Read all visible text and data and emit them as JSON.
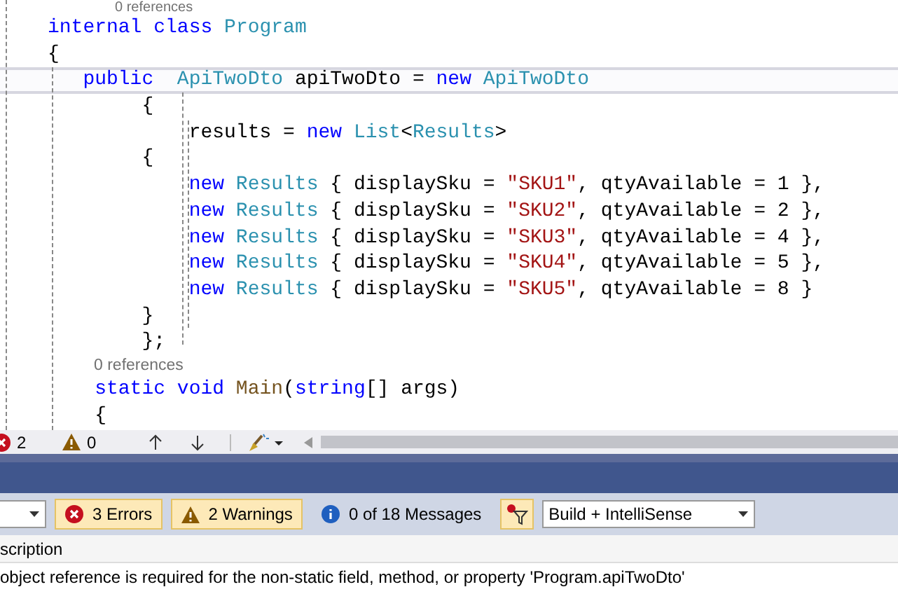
{
  "editor": {
    "lines": [
      {
        "kind": "lens",
        "text": "0 references"
      },
      {
        "kind": "code",
        "current": false,
        "tokens": [
          {
            "kind": "keyword",
            "s": "internal "
          },
          {
            "kind": "keyword",
            "s": "class "
          },
          {
            "kind": "type",
            "s": "Program"
          }
        ]
      },
      {
        "kind": "code",
        "current": false,
        "tokens": [
          {
            "kind": "plain",
            "s": "{"
          }
        ]
      },
      {
        "kind": "code",
        "current": true,
        "tokens": [
          {
            "kind": "keyword",
            "s": "   public  "
          },
          {
            "kind": "type",
            "s": "ApiTwoDto "
          },
          {
            "kind": "plain",
            "s": "apiTwoDto = "
          },
          {
            "kind": "keyword",
            "s": "new "
          },
          {
            "kind": "type",
            "s": "ApiTwoDto"
          }
        ]
      },
      {
        "kind": "code",
        "current": false,
        "tokens": [
          {
            "kind": "plain",
            "s": "        {"
          }
        ]
      },
      {
        "kind": "code",
        "current": false,
        "tokens": [
          {
            "kind": "plain",
            "s": "            results = "
          },
          {
            "kind": "keyword",
            "s": "new "
          },
          {
            "kind": "type",
            "s": "List"
          },
          {
            "kind": "plain",
            "s": "<"
          },
          {
            "kind": "type",
            "s": "Results"
          },
          {
            "kind": "plain",
            "s": ">"
          }
        ]
      },
      {
        "kind": "code",
        "current": false,
        "tokens": [
          {
            "kind": "plain",
            "s": "        {"
          }
        ]
      },
      {
        "kind": "code",
        "current": false,
        "tokens": [
          {
            "kind": "keyword",
            "s": "            new "
          },
          {
            "kind": "type",
            "s": "Results "
          },
          {
            "kind": "plain",
            "s": "{ displaySku = "
          },
          {
            "kind": "string",
            "s": "\"SKU1\""
          },
          {
            "kind": "plain",
            "s": ", qtyAvailable = 1 },"
          }
        ]
      },
      {
        "kind": "code",
        "current": false,
        "tokens": [
          {
            "kind": "keyword",
            "s": "            new "
          },
          {
            "kind": "type",
            "s": "Results "
          },
          {
            "kind": "plain",
            "s": "{ displaySku = "
          },
          {
            "kind": "string",
            "s": "\"SKU2\""
          },
          {
            "kind": "plain",
            "s": ", qtyAvailable = 2 },"
          }
        ]
      },
      {
        "kind": "code",
        "current": false,
        "tokens": [
          {
            "kind": "keyword",
            "s": "            new "
          },
          {
            "kind": "type",
            "s": "Results "
          },
          {
            "kind": "plain",
            "s": "{ displaySku = "
          },
          {
            "kind": "string",
            "s": "\"SKU3\""
          },
          {
            "kind": "plain",
            "s": ", qtyAvailable = 4 },"
          }
        ]
      },
      {
        "kind": "code",
        "current": false,
        "tokens": [
          {
            "kind": "keyword",
            "s": "            new "
          },
          {
            "kind": "type",
            "s": "Results "
          },
          {
            "kind": "plain",
            "s": "{ displaySku = "
          },
          {
            "kind": "string",
            "s": "\"SKU4\""
          },
          {
            "kind": "plain",
            "s": ", qtyAvailable = 5 },"
          }
        ]
      },
      {
        "kind": "code",
        "current": false,
        "tokens": [
          {
            "kind": "keyword",
            "s": "            new "
          },
          {
            "kind": "type",
            "s": "Results "
          },
          {
            "kind": "plain",
            "s": "{ displaySku = "
          },
          {
            "kind": "string",
            "s": "\"SKU5\""
          },
          {
            "kind": "plain",
            "s": ", qtyAvailable = 8 }"
          }
        ]
      },
      {
        "kind": "code",
        "current": false,
        "tokens": [
          {
            "kind": "plain",
            "s": "        }"
          }
        ]
      },
      {
        "kind": "code",
        "current": false,
        "tokens": [
          {
            "kind": "plain",
            "s": "        };"
          }
        ]
      },
      {
        "kind": "lens",
        "text": "0 references"
      },
      {
        "kind": "code",
        "current": false,
        "tokens": [
          {
            "kind": "keyword",
            "s": "    static void "
          },
          {
            "kind": "method",
            "s": "Main"
          },
          {
            "kind": "plain",
            "s": "("
          },
          {
            "kind": "keyword",
            "s": "string"
          },
          {
            "kind": "plain",
            "s": "[] args)"
          }
        ]
      },
      {
        "kind": "code",
        "current": false,
        "tokens": [
          {
            "kind": "plain",
            "s": "    {"
          }
        ]
      }
    ]
  },
  "editor_status": {
    "errors": "2",
    "warnings": "0"
  },
  "error_list": {
    "filters": [
      {
        "kind": "error",
        "label": "3 Errors",
        "selected": true
      },
      {
        "kind": "warning",
        "label": "2 Warnings",
        "selected": true
      },
      {
        "kind": "info",
        "label": "0 of 18 Messages",
        "selected": false
      }
    ],
    "filter_toggle": {
      "selected": true
    },
    "scope": "Build + IntelliSense",
    "columns": [
      "scription"
    ],
    "rows": [
      "object reference is required for the non-static field, method, or property 'Program.apiTwoDto'"
    ]
  }
}
